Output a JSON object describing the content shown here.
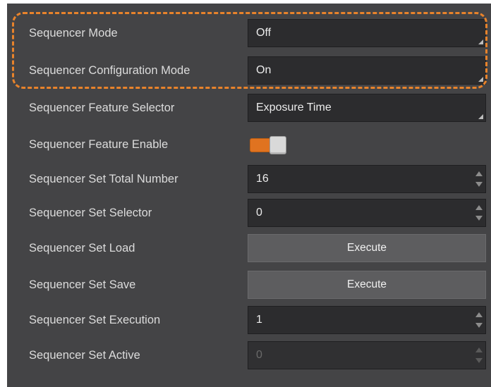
{
  "rows": [
    {
      "label": "Sequencer Mode",
      "value": "Off"
    },
    {
      "label": "Sequencer Configuration Mode",
      "value": "On"
    },
    {
      "label": "Sequencer Feature Selector",
      "value": "Exposure Time"
    },
    {
      "label": "Sequencer Feature Enable",
      "enabled": true
    },
    {
      "label": "Sequencer Set Total Number",
      "value": "16"
    },
    {
      "label": "Sequencer Set Selector",
      "value": "0"
    },
    {
      "label": "Sequencer Set Load",
      "button": "Execute"
    },
    {
      "label": "Sequencer Set Save",
      "button": "Execute"
    },
    {
      "label": "Sequencer Set Execution",
      "value": "1"
    },
    {
      "label": "Sequencer Set Active",
      "value": "0",
      "disabled": true
    }
  ],
  "colors": {
    "panel_bg": "#444446",
    "field_bg": "#2c2c2e",
    "accent_orange": "#e07320",
    "highlight_border": "#e8832b",
    "label_text": "#dcdcdc"
  },
  "icons": {
    "dropdown": "corner-triangle-icon",
    "spinner": "spin-up-down-icon"
  }
}
